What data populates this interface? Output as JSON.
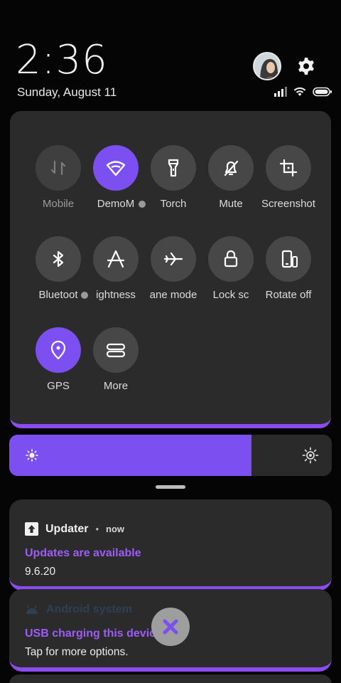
{
  "status": {
    "time": "2:36",
    "date": "Sunday, August 11",
    "icons": [
      "signal-icon",
      "wifi-icon",
      "battery-icon"
    ]
  },
  "quick_settings": {
    "tiles": [
      {
        "label": "Mobile",
        "icon": "mobile-data-icon",
        "state": "off"
      },
      {
        "label": "DemoM",
        "icon": "wifi-icon",
        "state": "on"
      },
      {
        "label": "Torch",
        "icon": "torch-icon",
        "state": "off"
      },
      {
        "label": "Mute",
        "icon": "mute-icon",
        "state": "off"
      },
      {
        "label": "Screenshot",
        "icon": "screenshot-icon",
        "state": "off"
      },
      {
        "label": "Bluetoot",
        "icon": "bluetooth-icon",
        "state": "off"
      },
      {
        "label": "ightness",
        "icon": "auto-brightness-icon",
        "state": "off"
      },
      {
        "label": "ane mode",
        "icon": "airplane-icon",
        "state": "off"
      },
      {
        "label": "Lock sc",
        "icon": "lock-icon",
        "state": "off"
      },
      {
        "label": "Rotate off",
        "icon": "rotate-icon",
        "state": "off"
      },
      {
        "label": "GPS",
        "icon": "gps-icon",
        "state": "on"
      },
      {
        "label": "More",
        "icon": "more-icon",
        "state": "off"
      }
    ]
  },
  "brightness": {
    "level_percent": 75,
    "icons": [
      "sun-low-icon",
      "sun-high-icon"
    ]
  },
  "notifications": [
    {
      "app": "Updater",
      "separator": "•",
      "time": "now",
      "title": "Updates are available",
      "body": "9.6.20",
      "icon": "upload-arrow-icon"
    },
    {
      "app": "Android system",
      "title": "USB charging this device",
      "body": "Tap for more options.",
      "icon": "android-icon"
    }
  ],
  "colors": {
    "accent": "#7c4ff0",
    "accent_text": "#9d5cf7",
    "panel": "#2b2b2b",
    "tile_off": "#474747",
    "background": "#050505"
  }
}
